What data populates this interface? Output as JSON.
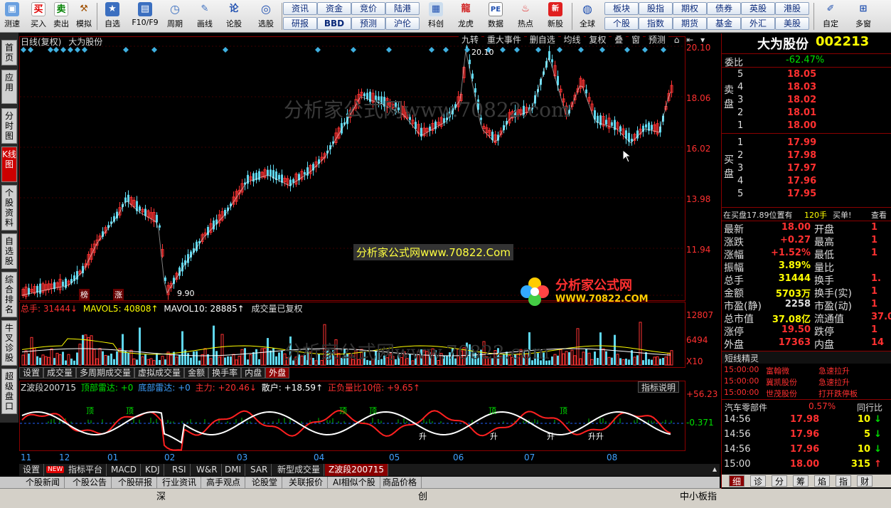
{
  "toolbar": {
    "buttons": [
      {
        "label": "测速",
        "icon": "speed-icon"
      },
      {
        "label": "买入",
        "glyph": "买",
        "color": "#e00000"
      },
      {
        "label": "卖出",
        "glyph": "卖",
        "color": "#008000"
      },
      {
        "label": "模拟",
        "icon": "hammer-icon"
      },
      {
        "label": "自选",
        "icon": "star-icon"
      },
      {
        "label": "F10/F9",
        "icon": "f10-icon"
      },
      {
        "label": "周期",
        "icon": "clock-icon"
      },
      {
        "label": "画线",
        "icon": "pen-icon"
      },
      {
        "label": "论股",
        "icon": "discuss-icon"
      },
      {
        "label": "选股",
        "icon": "select-icon"
      }
    ],
    "small_buttons_row1": [
      "资讯",
      "资金",
      "竞价",
      "陆港"
    ],
    "small_buttons_row2": [
      "研报",
      "BBD",
      "预测",
      "沪伦"
    ],
    "mid_buttons": [
      "科创",
      "龙虎",
      "数据",
      "热点",
      "新股",
      "全球"
    ],
    "right_row1": [
      "板块",
      "股指",
      "期权",
      "债券",
      "英股",
      "港股"
    ],
    "right_row2": [
      "个股",
      "指数",
      "期货",
      "基金",
      "外汇",
      "美股"
    ],
    "far_right": [
      "自定",
      "多窗"
    ]
  },
  "left_tabs": [
    {
      "label": "首页",
      "active": false
    },
    {
      "label": "应用",
      "active": false
    },
    {
      "label": "分时图",
      "active": false
    },
    {
      "label": "K线图",
      "active": true
    },
    {
      "label": "个股资料",
      "active": false
    },
    {
      "label": "自选股",
      "active": false
    },
    {
      "label": "综合排名",
      "active": false
    },
    {
      "label": "牛叉诊股",
      "active": false
    },
    {
      "label": "超级盘口",
      "active": false
    }
  ],
  "chart_header": {
    "period": "日线(复权)",
    "name": "大为股份",
    "tools": [
      "九转",
      "重大事件",
      "删自选",
      "均线",
      "复权",
      "叠",
      "窗",
      "预测"
    ]
  },
  "watermarks": {
    "center": "分析家公式网www.70822.Com",
    "faded": "分析家公式网www.70822.com",
    "logo_title": "分析家公式网",
    "logo_url": "WWW.70822.COM"
  },
  "price_axis": [
    "20.10",
    "18.06",
    "16.02",
    "13.98",
    "11.94",
    "9.90"
  ],
  "price_annotations": {
    "high": "20.10",
    "low": "9.90",
    "tag1": "榜",
    "tag2": "涨"
  },
  "volume": {
    "total_label": "总手: 31444↓",
    "ma5": "MAVOL5: 40808↑",
    "ma10": "MAVOL10: 28885↑",
    "note": "成交量已复权",
    "axis": [
      "12807",
      "6494",
      "X10"
    ],
    "tabs": [
      "设置",
      "成交量",
      "多周期成交量",
      "虚拟成交量",
      "金额",
      "换手率",
      "内盘",
      "外盘"
    ],
    "active_tab": "外盘"
  },
  "indicator": {
    "name": "Z波段200715",
    "top_radar": "顶部雷达: +0",
    "bottom_radar": "底部雷达: +0",
    "main": "主力: +20.46↓",
    "retail": "散户: +18.59↑",
    "ratio": "正负量比10倍: +9.65↑",
    "help": "指标说明",
    "axis_top": "+56.23",
    "axis_mid": "-0.371",
    "labels_top": [
      "顶",
      "顶",
      "顶",
      "顶",
      "顶",
      "顶"
    ],
    "labels_bottom": [
      "升",
      "升",
      "升",
      "升升"
    ]
  },
  "x_axis": [
    "11",
    "12",
    "01",
    "02",
    "03",
    "04",
    "05",
    "06",
    "07",
    "08"
  ],
  "bottom_tabs1": [
    "设置",
    "指标平台",
    "MACD",
    "KDJ",
    "RSI",
    "W&R",
    "DMI",
    "SAR",
    "新型成交量",
    "Z波段200715"
  ],
  "bottom_tabs1_new": "NEW",
  "bottom_tabs2": [
    "个股新闻",
    "个股公告",
    "个股研报",
    "行业资讯",
    "高手观点",
    "论股堂",
    "关联报价",
    "AI相似个股",
    "商品价格"
  ],
  "status_items": [
    "深",
    "创",
    "中小板指"
  ],
  "quote": {
    "name": "大为股份",
    "code": "002213",
    "weibi_label": "委比",
    "weibi": "-62.47%",
    "sell_label": "卖盘",
    "buy_label": "买盘",
    "sell": [
      {
        "lvl": "5",
        "price": "18.05"
      },
      {
        "lvl": "4",
        "price": "18.03"
      },
      {
        "lvl": "3",
        "price": "18.02"
      },
      {
        "lvl": "2",
        "price": "18.01"
      },
      {
        "lvl": "1",
        "price": "18.00"
      }
    ],
    "buy": [
      {
        "lvl": "1",
        "price": "17.99"
      },
      {
        "lvl": "2",
        "price": "17.98"
      },
      {
        "lvl": "3",
        "price": "17.97"
      },
      {
        "lvl": "4",
        "price": "17.96"
      },
      {
        "lvl": "5",
        "price": "17.95"
      }
    ],
    "alert": "在买盘17.89位置有",
    "alert_vol": "120手",
    "alert_action": "买单!",
    "alert_more": "查看",
    "stats": [
      {
        "k1": "最新",
        "v1": "18.00",
        "k2": "开盘",
        "v2": "1",
        "c1": "r-red"
      },
      {
        "k1": "涨跌",
        "v1": "+0.27",
        "k2": "最高",
        "v2": "1",
        "c1": "r-red"
      },
      {
        "k1": "涨幅",
        "v1": "+1.52%",
        "k2": "最低",
        "v2": "1",
        "c1": "r-red"
      },
      {
        "k1": "振幅",
        "v1": "3.89%",
        "k2": "量比",
        "v2": "",
        "c1": "r-yellow"
      },
      {
        "k1": "总手",
        "v1": "31444",
        "k2": "换手",
        "v2": "1.",
        "c1": "r-yellow"
      },
      {
        "k1": "金额",
        "v1": "5703万",
        "k2": "换手(实)",
        "v2": "1",
        "c1": "r-yellow"
      },
      {
        "k1": "市盈(静)",
        "v1": "2258",
        "k2": "市盈(动)",
        "v2": "1",
        "c1": "r-white"
      },
      {
        "k1": "总市值",
        "v1": "37.08亿",
        "k2": "流通值",
        "v2": "37.0",
        "c1": "r-yellow"
      },
      {
        "k1": "涨停",
        "v1": "19.50",
        "k2": "跌停",
        "v2": "1",
        "c1": "r-red"
      },
      {
        "k1": "外盘",
        "v1": "17363",
        "k2": "内盘",
        "v2": "14",
        "c1": "r-red"
      }
    ],
    "elf_title": "短线精灵",
    "elf": [
      {
        "time": "15:00:00",
        "stock": "富翰微",
        "event": "急速拉升"
      },
      {
        "time": "15:00:00",
        "stock": "冀凯股份",
        "event": "急速拉升"
      },
      {
        "time": "15:00:00",
        "stock": "世茂股份",
        "event": "打开跌停板"
      }
    ],
    "sector": "汽车零部件",
    "sector_pct": "0.57%",
    "sector_more": "同行比",
    "ticks": [
      {
        "time": "14:56",
        "price": "17.98",
        "vol": "10",
        "dir": "down"
      },
      {
        "time": "14:56",
        "price": "17.96",
        "vol": "5",
        "dir": "down"
      },
      {
        "time": "14:56",
        "price": "17.96",
        "vol": "10",
        "dir": "down"
      },
      {
        "time": "15:00",
        "price": "18.00",
        "vol": "315",
        "dir": "up"
      }
    ],
    "tabs": [
      "细",
      "诊",
      "分",
      "筹",
      "焰",
      "指",
      "财"
    ]
  },
  "colors": {
    "up": "#ff3333",
    "down": "#5fd7ee",
    "ma": "#ffffff",
    "frame": "#8b0000"
  }
}
